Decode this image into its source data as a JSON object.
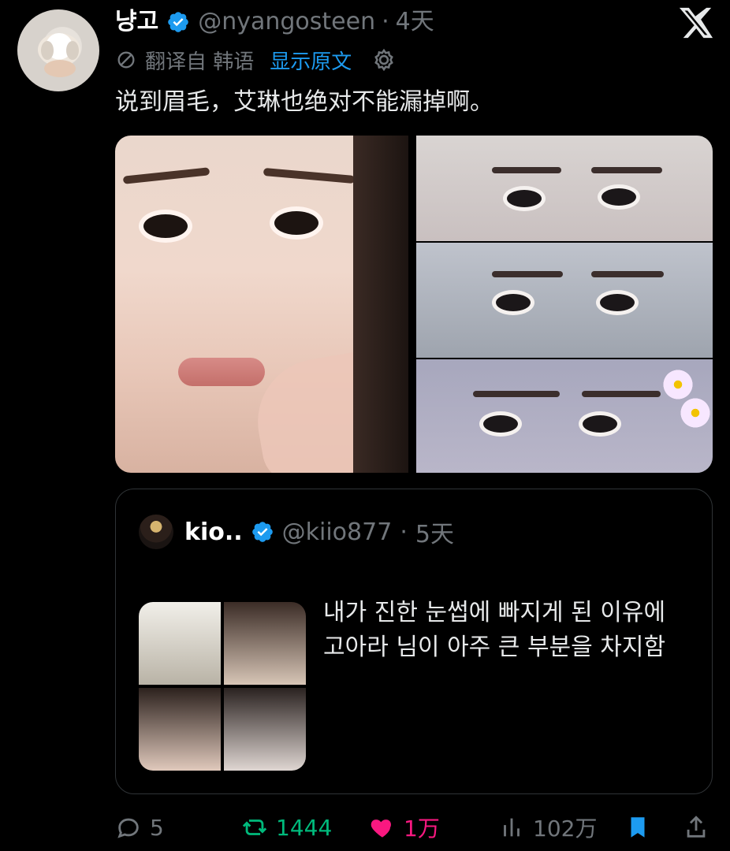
{
  "tweet": {
    "display_name": "냥고",
    "handle": "@nyangosteen",
    "dot": "·",
    "time": "4天",
    "translated_from": "翻译自 韩语",
    "show_original": "显示原文",
    "text": "说到眉毛，艾琳也绝对不能漏掉啊。"
  },
  "quote": {
    "display_name": "kio..",
    "handle": "@kiio877",
    "dot": "·",
    "time": "5天",
    "text_line1": "내가 진한 눈썹에 빠지게 된 이유에",
    "text_line2": "고아라 님이 아주 큰 부분을 차지함"
  },
  "actions": {
    "replies": "5",
    "retweets": "1444",
    "likes": "1万",
    "views": "102万"
  },
  "colors": {
    "background": "#000000",
    "text": "#e7e9ea",
    "muted": "#71767b",
    "accent": "#1d9bf0",
    "retweet": "#00ba7c",
    "like": "#f91880"
  },
  "icons": {
    "verified": "verified-badge-icon",
    "close": "x-logo-icon",
    "translate": "translate-icon",
    "settings": "gear-icon",
    "reply": "reply-icon",
    "retweet": "retweet-icon",
    "like": "heart-icon",
    "views": "views-icon",
    "bookmark": "bookmark-icon",
    "share": "share-icon"
  }
}
